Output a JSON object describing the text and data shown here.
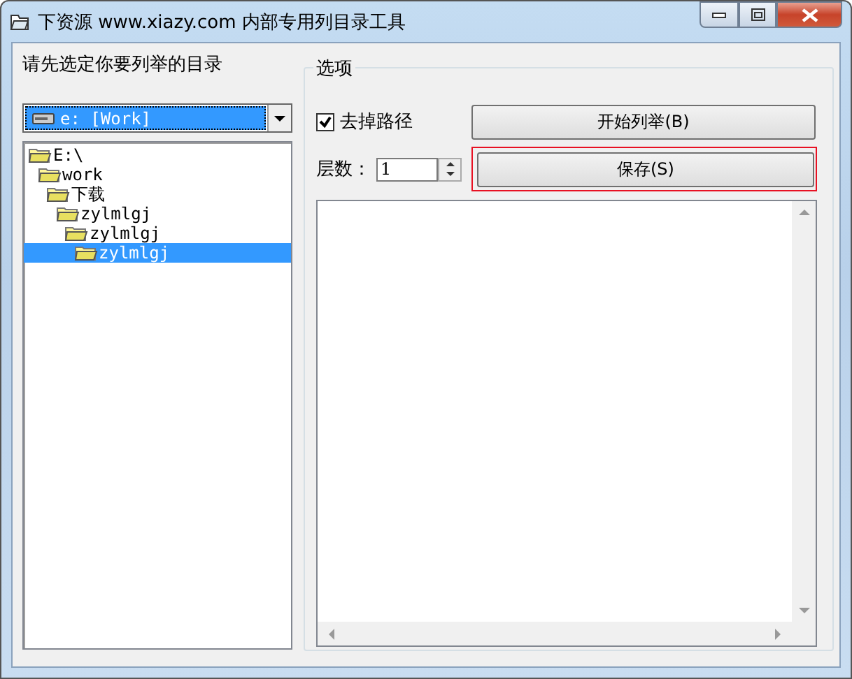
{
  "window": {
    "title": "下资源 www.xiazy.com 内部专用列目录工具"
  },
  "directory_label": "请先选定你要列举的目录",
  "drive_select": {
    "value": "e: [Work]"
  },
  "tree": [
    {
      "label": "E:\\",
      "selected": false,
      "children": [
        {
          "label": "work",
          "selected": false,
          "children": [
            {
              "label": "下载",
              "selected": false,
              "children": [
                {
                  "label": "zylmlgj",
                  "selected": false,
                  "children": [
                    {
                      "label": "zylmlgj",
                      "selected": false,
                      "children": [
                        {
                          "label": "zylmlgj",
                          "selected": true
                        }
                      ]
                    }
                  ]
                }
              ]
            }
          ]
        }
      ]
    }
  ],
  "options": {
    "title": "选项",
    "checkbox": {
      "label": "去掉路径",
      "checked": true
    },
    "levels": {
      "label": "层数：",
      "value": "1"
    },
    "buttons": [
      {
        "label": "开始列举(B)",
        "focused": false
      },
      {
        "label": "保存(S)",
        "focused": true
      }
    ]
  }
}
